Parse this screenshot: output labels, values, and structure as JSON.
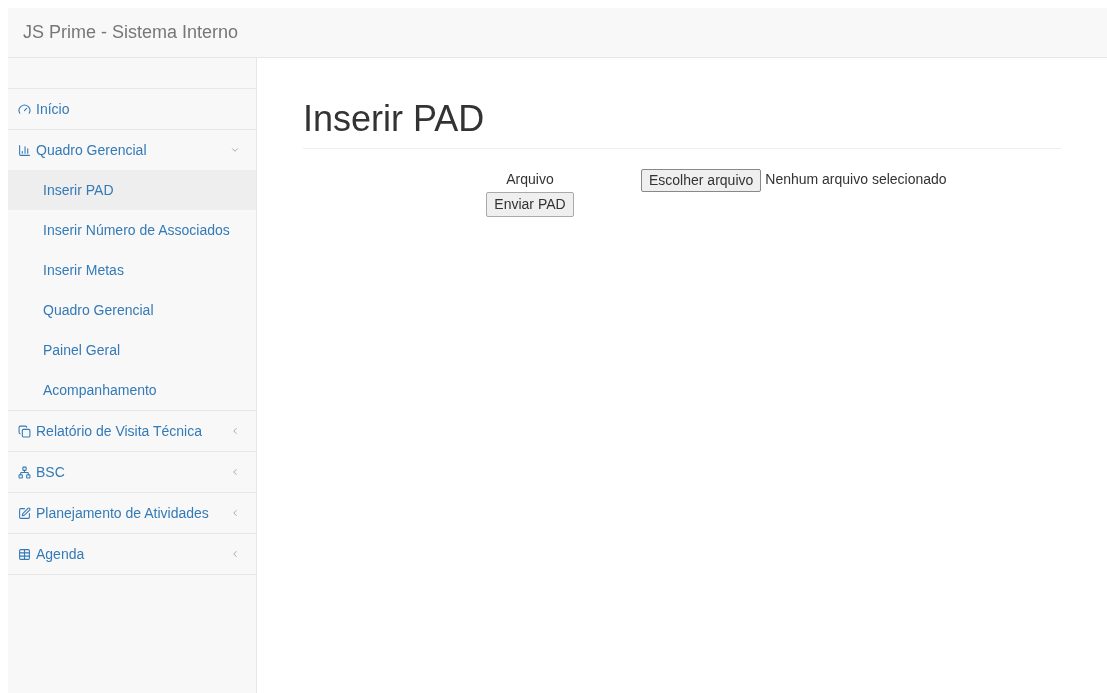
{
  "navbar": {
    "brand": "JS Prime - Sistema Interno"
  },
  "sidebar": {
    "items": [
      {
        "kind": "link",
        "label": "Início"
      },
      {
        "kind": "menu",
        "label": "Quadro Gerencial",
        "expanded": true,
        "children": [
          {
            "label": "Inserir PAD",
            "selected": true
          },
          {
            "label": "Inserir Número de Associados",
            "selected": false
          },
          {
            "label": "Inserir Metas",
            "selected": false
          },
          {
            "label": "Quadro Gerencial",
            "selected": false
          },
          {
            "label": "Painel Geral",
            "selected": false
          },
          {
            "label": "Acompanhamento",
            "selected": false
          }
        ]
      },
      {
        "kind": "menu",
        "label": "Relatório de Visita Técnica",
        "expanded": false
      },
      {
        "kind": "menu",
        "label": "BSC",
        "expanded": false
      },
      {
        "kind": "menu",
        "label": "Planejamento de Atividades",
        "expanded": false
      },
      {
        "kind": "menu",
        "label": "Agenda",
        "expanded": false
      }
    ]
  },
  "page": {
    "title": "Inserir PAD",
    "form": {
      "label": "Arquivo",
      "file_button": "Escolher arquivo",
      "file_status": "Nenhum arquivo selecionado",
      "submit": "Enviar PAD"
    }
  }
}
